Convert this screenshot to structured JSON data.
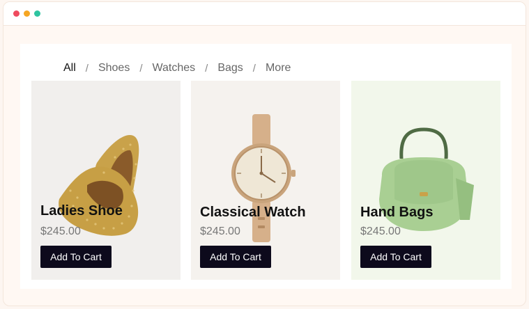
{
  "window": {
    "controls": [
      "close",
      "minimize",
      "zoom"
    ]
  },
  "nav": {
    "items": [
      {
        "label": "All",
        "active": true
      },
      {
        "label": "Shoes"
      },
      {
        "label": "Watches"
      },
      {
        "label": "Bags"
      },
      {
        "label": "More"
      }
    ],
    "separator": "/"
  },
  "products": [
    {
      "name": "Ladies Shoe",
      "price": "$245.00",
      "cta": "Add To Cart",
      "icon": "shoe-image"
    },
    {
      "name": "Classical Watch",
      "price": "$245.00",
      "cta": "Add To Cart",
      "icon": "watch-image"
    },
    {
      "name": "Hand Bags",
      "price": "$245.00",
      "cta": "Add To Cart",
      "icon": "handbag-image"
    }
  ],
  "colors": {
    "accent_button": "#0d0a1c",
    "card_bg_1": "#f1efed",
    "card_bg_2": "#f5f2ee",
    "card_bg_3": "#f2f7eb"
  }
}
